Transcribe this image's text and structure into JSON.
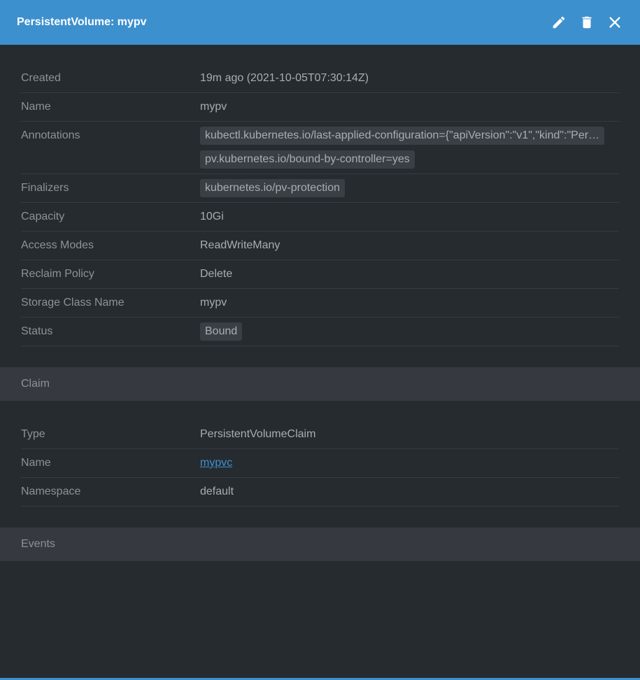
{
  "header": {
    "title": "PersistentVolume: mypv",
    "actions": [
      {
        "name": "edit-icon"
      },
      {
        "name": "delete-icon"
      },
      {
        "name": "close-icon"
      }
    ]
  },
  "details": {
    "created": {
      "label": "Created",
      "value": "19m ago (2021-10-05T07:30:14Z)"
    },
    "name": {
      "label": "Name",
      "value": "mypv"
    },
    "annotations": {
      "label": "Annotations",
      "items": [
        "kubectl.kubernetes.io/last-applied-configuration={\"apiVersion\":\"v1\",\"kind\":\"Per…",
        "pv.kubernetes.io/bound-by-controller=yes"
      ]
    },
    "finalizers": {
      "label": "Finalizers",
      "items": [
        "kubernetes.io/pv-protection"
      ]
    },
    "capacity": {
      "label": "Capacity",
      "value": "10Gi"
    },
    "access_modes": {
      "label": "Access Modes",
      "value": "ReadWriteMany"
    },
    "reclaim_policy": {
      "label": "Reclaim Policy",
      "value": "Delete"
    },
    "storage_class": {
      "label": "Storage Class Name",
      "value": "mypv"
    },
    "status": {
      "label": "Status",
      "value": "Bound"
    }
  },
  "claim": {
    "title": "Claim",
    "type": {
      "label": "Type",
      "value": "PersistentVolumeClaim"
    },
    "name": {
      "label": "Name",
      "value": "mypvc"
    },
    "namespace": {
      "label": "Namespace",
      "value": "default"
    }
  },
  "events": {
    "title": "Events"
  },
  "colors": {
    "accent": "#3d90ce",
    "background": "#262b30",
    "chip": "#3a3f45",
    "subheader": "#363a40"
  }
}
